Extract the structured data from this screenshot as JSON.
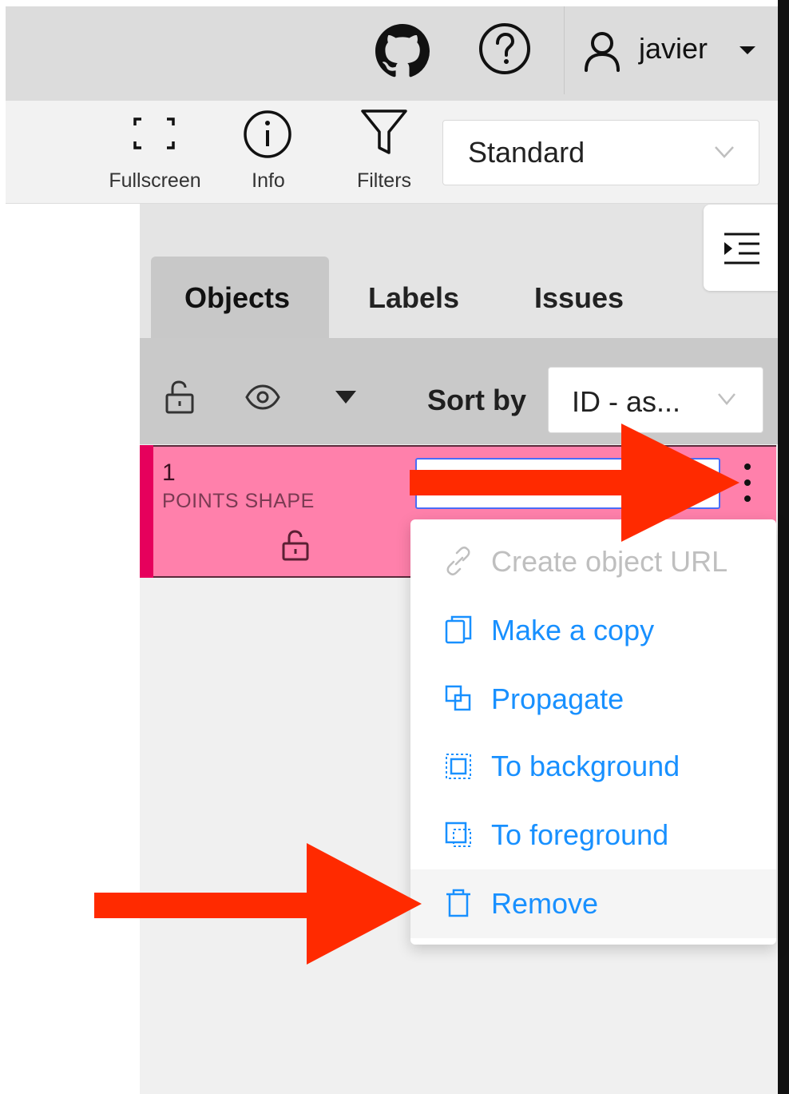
{
  "header": {
    "username": "javier",
    "icons": [
      "github-icon",
      "help-icon",
      "user-icon",
      "caret-down-icon"
    ]
  },
  "toolbar": {
    "fullscreen_label": "Fullscreen",
    "info_label": "Info",
    "filters_label": "Filters",
    "workspace_value": "Standard"
  },
  "sidebar": {
    "tabs": [
      {
        "label": "Objects",
        "active": true
      },
      {
        "label": "Labels",
        "active": false
      },
      {
        "label": "Issues",
        "active": false
      }
    ],
    "sort_label": "Sort by",
    "sort_value": "ID - as..."
  },
  "object": {
    "id": "1",
    "type": "POINTS SHAPE",
    "color": "#ff80ab"
  },
  "context_menu": {
    "items": [
      {
        "label": "Create object URL",
        "icon": "link-icon",
        "disabled": true
      },
      {
        "label": "Make a copy",
        "icon": "copy-icon",
        "disabled": false
      },
      {
        "label": "Propagate",
        "icon": "propagate-icon",
        "disabled": false
      },
      {
        "label": "To background",
        "icon": "to-background-icon",
        "disabled": false
      },
      {
        "label": "To foreground",
        "icon": "to-foreground-icon",
        "disabled": false
      },
      {
        "label": "Remove",
        "icon": "trash-icon",
        "disabled": false,
        "hovered": true
      }
    ]
  },
  "colors": {
    "accent": "#1890ff",
    "annotation_arrow": "#ff2a00",
    "header_bg": "#dcdcdc",
    "object_stripe": "#e6005c"
  }
}
